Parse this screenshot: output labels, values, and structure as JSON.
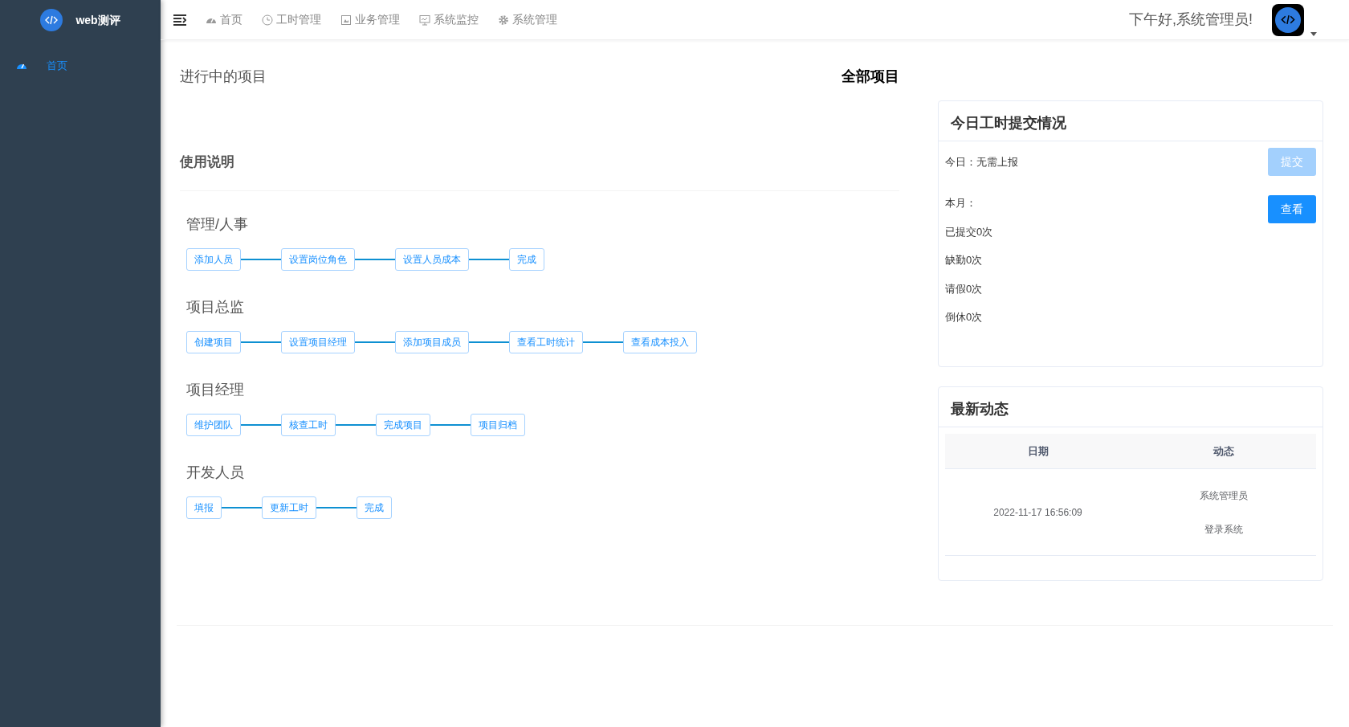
{
  "sidebar": {
    "logo_text": "web测评",
    "items": [
      {
        "label": "首页",
        "kind": "gauge",
        "selected": true
      }
    ]
  },
  "topbar": {
    "nav": [
      {
        "label": "首页",
        "kind": "gauge"
      },
      {
        "label": "工时管理",
        "kind": "clock"
      },
      {
        "label": "业务管理",
        "kind": "frame"
      },
      {
        "label": "系统监控",
        "kind": "monitor"
      },
      {
        "label": "系统管理",
        "kind": "gear"
      }
    ],
    "greeting": "下午好,系统管理员!"
  },
  "projects": {
    "title": "进行中的项目",
    "link": "全部项目"
  },
  "guide": {
    "title": "使用说明",
    "flows": [
      {
        "role": "管理/人事",
        "steps": [
          "添加人员",
          "设置岗位角色",
          "设置人员成本",
          "完成"
        ]
      },
      {
        "role": "项目总监",
        "steps": [
          "创建项目",
          "设置项目经理",
          "添加项目成员",
          "查看工时统计",
          "查看成本投入"
        ]
      },
      {
        "role": "项目经理",
        "steps": [
          "维护团队",
          "核查工时",
          "完成项目",
          "项目归档"
        ]
      },
      {
        "role": "开发人员",
        "steps": [
          "填报",
          "更新工时",
          "完成"
        ]
      }
    ]
  },
  "timesheet": {
    "title": "今日工时提交情况",
    "today": "今日：无需上报",
    "submit": {
      "label": "提交",
      "disabled": true
    },
    "month": "本月：",
    "view": {
      "label": "查看",
      "disabled": false
    },
    "stats": [
      "已提交0次",
      "缺勤0次",
      "请假0次",
      "倒休0次"
    ]
  },
  "activity": {
    "title": "最新动态",
    "columns": [
      "日期",
      "动态"
    ],
    "rows": [
      {
        "date": "2022-11-17 16:56:09",
        "user": "系统管理员",
        "action": "登录系统"
      }
    ]
  }
}
